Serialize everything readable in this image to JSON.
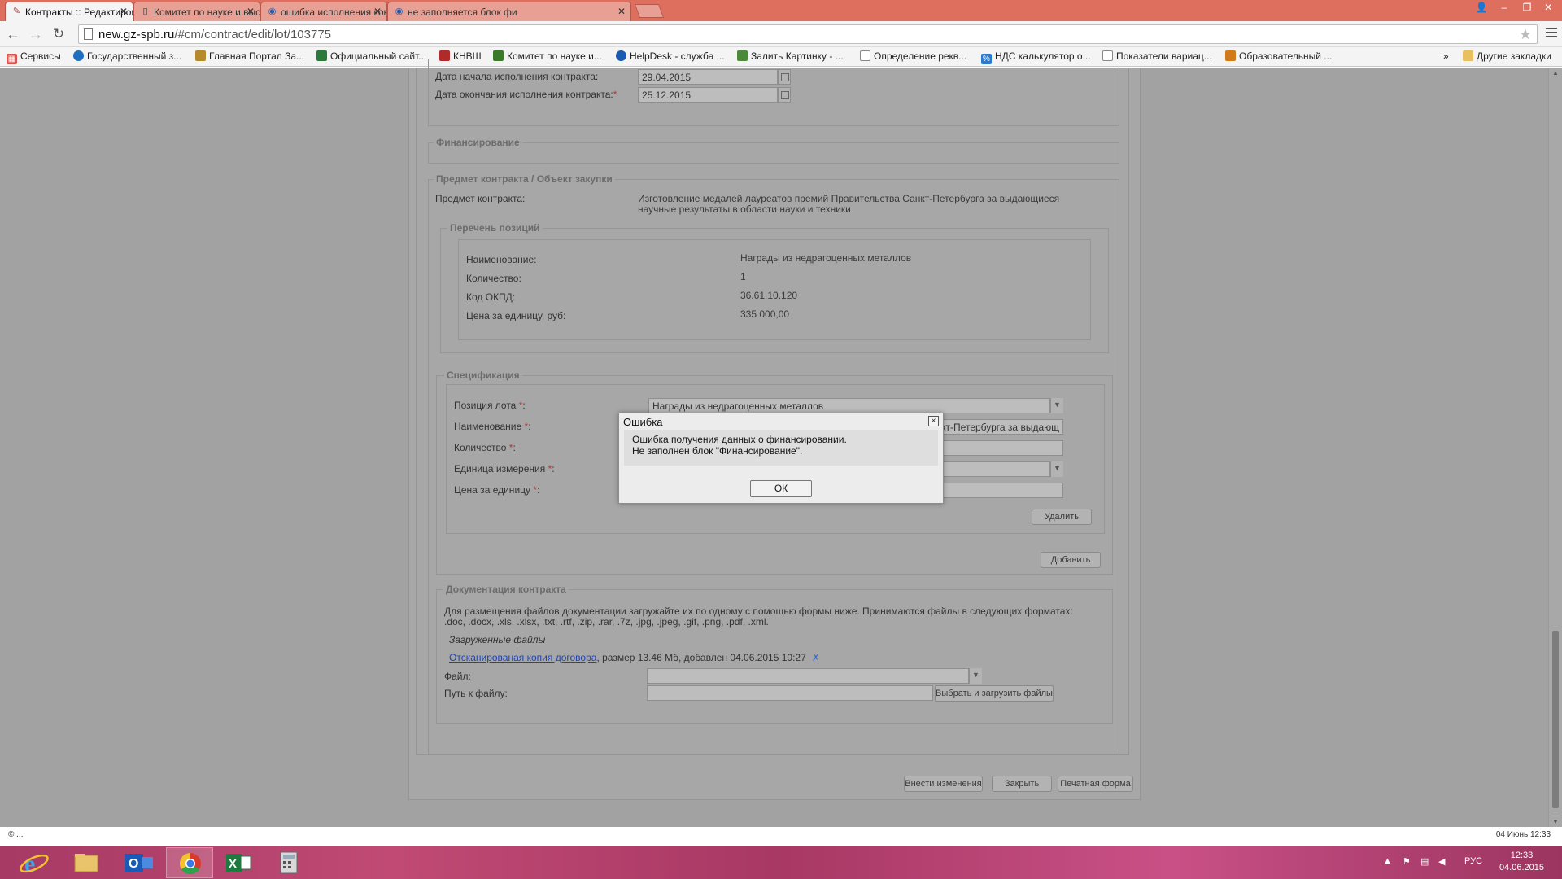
{
  "browser": {
    "tabs": [
      {
        "title": "Контракты :: Редактиров",
        "active": true
      },
      {
        "title": "Комитет по науке и выс",
        "active": false
      },
      {
        "title": "ошибка исполнения кон",
        "active": false
      },
      {
        "title": "не заполняется блок фи",
        "active": false
      }
    ],
    "url_host": "new.gz-spb.ru",
    "url_path": "/#cm/contract/edit/lot/103775",
    "bookmarks": [
      "Сервисы",
      "Государственный з...",
      "Главная Портал За...",
      "Официальный сайт...",
      "КНВШ",
      "Комитет по науке и...",
      "HelpDesk - служба ...",
      "Залить Картинку - ...",
      "Определение рекв...",
      "НДС калькулятор о...",
      "Показатели вариац...",
      "Образовательный ..."
    ],
    "bookmarks_more": "»",
    "other_bookmarks": "Другие закладки"
  },
  "dates": {
    "start_label": "Дата начала исполнения контракта:",
    "start_value": "29.04.2015",
    "end_label": "Дата окончания исполнения контракта:",
    "end_req": "*",
    "end_value": "25.12.2015"
  },
  "financing": {
    "legend": "Финансирование"
  },
  "subject": {
    "legend": "Предмет контракта / Объект закупки",
    "label": "Предмет контракта:",
    "value_line1": "Изготовление медалей лауреатов премий Правительства Санкт-Петербурга за выдающиеся",
    "value_line2": "научные результаты в области науки и техники"
  },
  "positions": {
    "legend": "Перечень позиций",
    "rows": [
      {
        "label": "Наименование:",
        "value": "Награды из недрагоценных металлов"
      },
      {
        "label": "Количество:",
        "value": "1"
      },
      {
        "label": "Код ОКПД:",
        "value": "36.61.10.120"
      },
      {
        "label": "Цена за единицу, руб:",
        "value": "335 000,00"
      }
    ]
  },
  "spec": {
    "legend": "Спецификация",
    "lot_label": "Позиция лота",
    "lot_value": "Награды из недрагоценных металлов",
    "name_label": "Наименование",
    "name_value": "тва Санкт-Петербурга за выдающ",
    "qty_label": "Количество",
    "unit_label": "Единица измерения",
    "price_label": "Цена за единицу",
    "req": "*",
    "colon": ":",
    "delete_button": "Удалить",
    "add_button": "Добавить"
  },
  "docs": {
    "legend": "Документация контракта",
    "info_line1": "Для размещения файлов документации загружайте их по одному с помощью формы ниже. Принимаются файлы в следующих форматах:",
    "info_line2": ".doc, .docx, .xls, .xlsx, .txt, .rtf, .zip, .rar, .7z, .jpg, .jpeg, .gif, .png, .pdf, .xml.",
    "uploaded_label": "Загруженные файлы",
    "file_link": "Отсканированая копия договора",
    "file_meta": ", размер 13.46 Мб, добавлен 04.06.2015 10:27",
    "file_label": "Файл:",
    "path_label": "Путь к файлу:",
    "upload_button": "Выбрать и загрузить файлы"
  },
  "footer_buttons": {
    "save": "Внести изменения",
    "close": "Закрыть",
    "print": "Печатная форма"
  },
  "dialog": {
    "title": "Ошибка",
    "close": "×",
    "line1": "Ошибка получения данных о финансировании.",
    "line2": "Не заполнен блок \"Финансирование\".",
    "ok": "ОК"
  },
  "status": {
    "left": "© ...",
    "right": "04 Июнь 12:33"
  },
  "taskbar": {
    "apps": [
      "internet-explorer",
      "file-explorer",
      "outlook",
      "chrome",
      "excel",
      "calculator"
    ],
    "lang": "РУС",
    "time": "12:33",
    "date": "04.06.2015"
  },
  "colors": {
    "tabstrip": "#de6e5e",
    "overlay": "#a2a2a2",
    "link": "#2244aa",
    "required": "#c43030"
  }
}
